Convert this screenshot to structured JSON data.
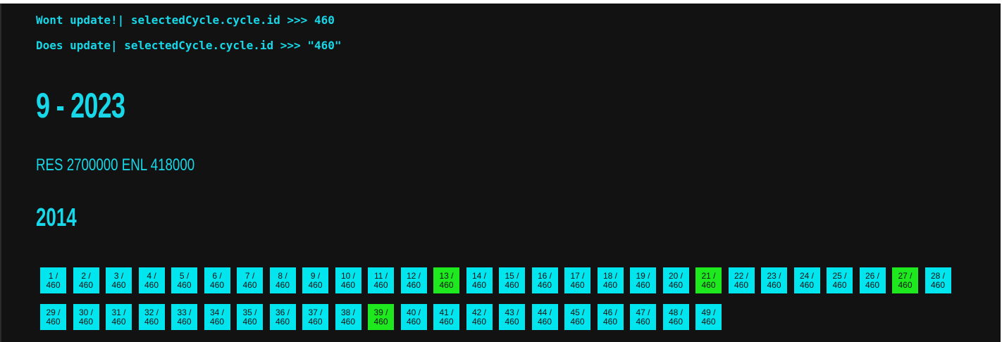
{
  "debug": {
    "line1": "Wont update!| selectedCycle.cycle.id >>> 460",
    "line2": "Does update| selectedCycle.cycle.id >>> \"460\""
  },
  "heading": "9 - 2023",
  "res_line": "RES 2700000 ENL 418000",
  "year": "2014",
  "colors": {
    "background": "#121212",
    "accent": "#17d7e8",
    "cell_default": "#00e5ee",
    "cell_highlight": "#1ee81e"
  },
  "cycle_total": "460",
  "cells": [
    {
      "num": "1 /",
      "total": "460",
      "highlight": false
    },
    {
      "num": "2 /",
      "total": "460",
      "highlight": false
    },
    {
      "num": "3 /",
      "total": "460",
      "highlight": false
    },
    {
      "num": "4 /",
      "total": "460",
      "highlight": false
    },
    {
      "num": "5 /",
      "total": "460",
      "highlight": false
    },
    {
      "num": "6 /",
      "total": "460",
      "highlight": false
    },
    {
      "num": "7 /",
      "total": "460",
      "highlight": false
    },
    {
      "num": "8 /",
      "total": "460",
      "highlight": false
    },
    {
      "num": "9 /",
      "total": "460",
      "highlight": false
    },
    {
      "num": "10 /",
      "total": "460",
      "highlight": false
    },
    {
      "num": "11 /",
      "total": "460",
      "highlight": false
    },
    {
      "num": "12 /",
      "total": "460",
      "highlight": false
    },
    {
      "num": "13 /",
      "total": "460",
      "highlight": true
    },
    {
      "num": "14 /",
      "total": "460",
      "highlight": false
    },
    {
      "num": "15 /",
      "total": "460",
      "highlight": false
    },
    {
      "num": "16 /",
      "total": "460",
      "highlight": false
    },
    {
      "num": "17 /",
      "total": "460",
      "highlight": false
    },
    {
      "num": "18 /",
      "total": "460",
      "highlight": false
    },
    {
      "num": "19 /",
      "total": "460",
      "highlight": false
    },
    {
      "num": "20 /",
      "total": "460",
      "highlight": false
    },
    {
      "num": "21 /",
      "total": "460",
      "highlight": true
    },
    {
      "num": "22 /",
      "total": "460",
      "highlight": false
    },
    {
      "num": "23 /",
      "total": "460",
      "highlight": false
    },
    {
      "num": "24 /",
      "total": "460",
      "highlight": false
    },
    {
      "num": "25 /",
      "total": "460",
      "highlight": false
    },
    {
      "num": "26 /",
      "total": "460",
      "highlight": false
    },
    {
      "num": "27 /",
      "total": "460",
      "highlight": true
    },
    {
      "num": "28 /",
      "total": "460",
      "highlight": false
    },
    {
      "num": "29 /",
      "total": "460",
      "highlight": false
    },
    {
      "num": "30 /",
      "total": "460",
      "highlight": false
    },
    {
      "num": "31 /",
      "total": "460",
      "highlight": false
    },
    {
      "num": "32 /",
      "total": "460",
      "highlight": false
    },
    {
      "num": "33 /",
      "total": "460",
      "highlight": false
    },
    {
      "num": "34 /",
      "total": "460",
      "highlight": false
    },
    {
      "num": "35 /",
      "total": "460",
      "highlight": false
    },
    {
      "num": "36 /",
      "total": "460",
      "highlight": false
    },
    {
      "num": "37 /",
      "total": "460",
      "highlight": false
    },
    {
      "num": "38 /",
      "total": "460",
      "highlight": false
    },
    {
      "num": "39 /",
      "total": "460",
      "highlight": true
    },
    {
      "num": "40 /",
      "total": "460",
      "highlight": false
    },
    {
      "num": "41 /",
      "total": "460",
      "highlight": false
    },
    {
      "num": "42 /",
      "total": "460",
      "highlight": false
    },
    {
      "num": "43 /",
      "total": "460",
      "highlight": false
    },
    {
      "num": "44 /",
      "total": "460",
      "highlight": false
    },
    {
      "num": "45 /",
      "total": "460",
      "highlight": false
    },
    {
      "num": "46 /",
      "total": "460",
      "highlight": false
    },
    {
      "num": "47 /",
      "total": "460",
      "highlight": false
    },
    {
      "num": "48 /",
      "total": "460",
      "highlight": false
    },
    {
      "num": "49 /",
      "total": "460",
      "highlight": false
    }
  ]
}
